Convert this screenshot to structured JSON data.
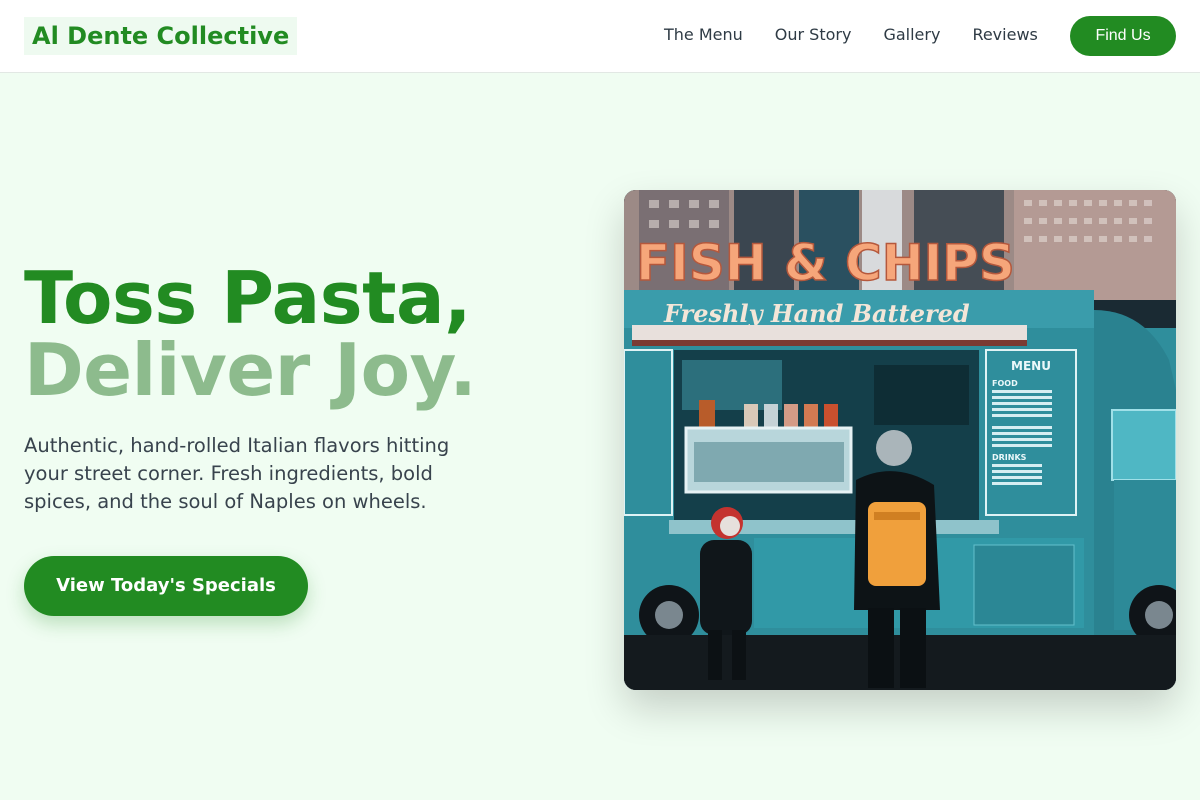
{
  "brand": {
    "name": "Al Dente Collective"
  },
  "nav": {
    "links": [
      "The Menu",
      "Our Story",
      "Gallery",
      "Reviews"
    ],
    "cta_label": "Find Us"
  },
  "hero": {
    "title_line1": "Toss Pasta,",
    "title_line2": "Deliver Joy.",
    "description": "Authentic, hand-rolled Italian flavors hitting your street corner. Fresh ingredients, bold spices, and the soul of Naples on wheels.",
    "cta_label": "View Today's Specials"
  },
  "photo": {
    "sign_text": "FISH & CHIPS",
    "script_text": "Freshly Hand Battered",
    "menu_title": "MENU",
    "menu_food": "FOOD",
    "menu_drinks": "DRINKS"
  },
  "colors": {
    "accent": "#228b22",
    "accent_light": "#8dbb8d",
    "page_bg": "#f0fdf2",
    "truck_teal": "#3aa6b5"
  }
}
